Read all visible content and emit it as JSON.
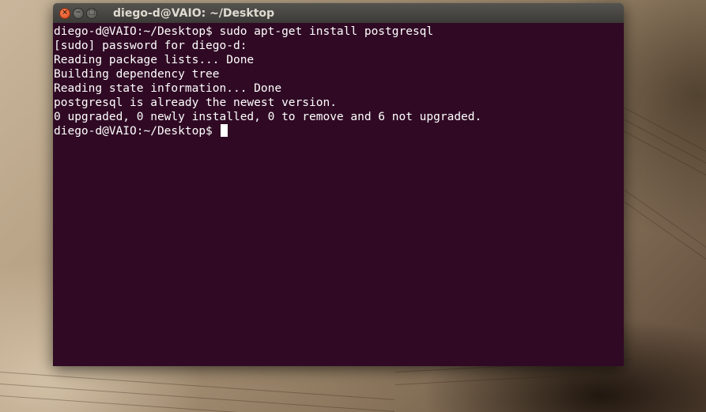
{
  "window": {
    "title": "diego-d@VAIO: ~/Desktop",
    "controls": {
      "close_icon": "×",
      "minimize_icon": "−",
      "maximize_icon": "□"
    }
  },
  "terminal": {
    "lines": [
      "diego-d@VAIO:~/Desktop$ sudo apt-get install postgresql",
      "[sudo] password for diego-d:",
      "Reading package lists... Done",
      "Building dependency tree",
      "Reading state information... Done",
      "postgresql is already the newest version.",
      "0 upgraded, 0 newly installed, 0 to remove and 6 not upgraded."
    ],
    "prompt": "diego-d@VAIO:~/Desktop$ ",
    "colors": {
      "background": "#300a24",
      "foreground": "#ffffff"
    }
  }
}
